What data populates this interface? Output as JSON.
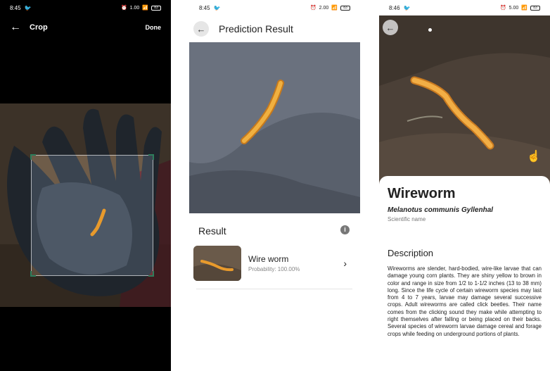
{
  "screens": {
    "crop": {
      "status": {
        "time": "8:45",
        "speed": "1.00",
        "battery": "83"
      },
      "header": {
        "title": "Crop",
        "done_label": "Done"
      }
    },
    "prediction": {
      "status": {
        "time": "8:45",
        "speed": "2.00",
        "battery": "83"
      },
      "header": {
        "title": "Prediction Result"
      },
      "result_heading": "Result",
      "result": {
        "name": "Wire worm",
        "probability": "Probability: 100.00%"
      }
    },
    "detail": {
      "status": {
        "time": "8:46",
        "speed": "5.00",
        "battery": "83"
      },
      "name": "Wireworm",
      "scientific_name": "Melanotus communis Gyllenhal",
      "scientific_label": "Scientific name",
      "description_heading": "Description",
      "description": "Wireworms are slender, hard-bodied, wire-like larvae that can damage young corn plants. They are shiny yellow to brown in color and range in size from 1/2 to 1-1/2 inches (13 to 38 mm) long. Since the life cycle of certain wireworm species may last from 4 to 7 years, larvae may damage several successive crops. Adult wireworms are called click beetles. Their name comes from the clicking sound they make while attempting to right themselves after falling or being placed on their backs. Several species of wireworm larvae damage cereal and forage crops while feeding on underground portions of plants."
    }
  },
  "icons": {
    "back": "arrow-left-icon",
    "info": "info-icon",
    "chevron": "chevron-right-icon",
    "swipe": "hand-pointer-icon"
  },
  "colors": {
    "crop_corner": "#2e7d5b",
    "worm": "#e89a2c"
  }
}
